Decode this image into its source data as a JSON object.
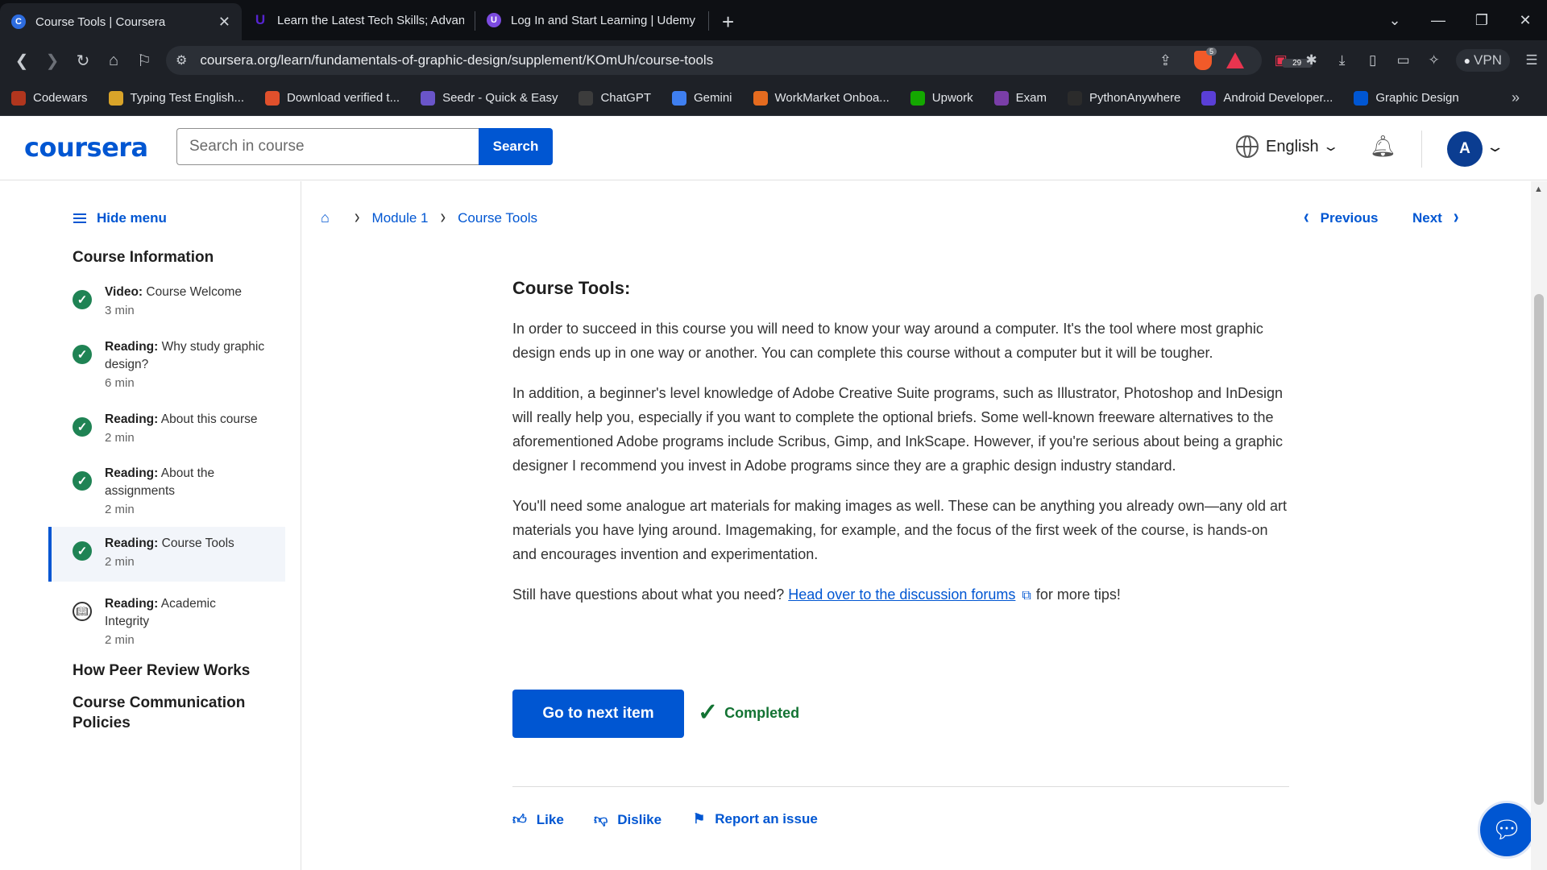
{
  "browser": {
    "tabs": [
      {
        "title": "Course Tools | Coursera",
        "active": true,
        "favicon": "coursera-favicon"
      },
      {
        "title": "Learn the Latest Tech Skills; Advanced",
        "active": false,
        "favicon": "udemy-favicon"
      },
      {
        "title": "Log In and Start Learning | Udemy",
        "active": false,
        "favicon": "udemy-favicon"
      }
    ],
    "url": "coursera.org/learn/fundamentals-of-graphic-design/supplement/KOmUh/course-tools",
    "extension_badges": {
      "brave_shields": "5",
      "ext_counter": "29"
    },
    "vpn_label": "VPN",
    "bookmarks": [
      {
        "label": "Codewars",
        "color": "#b1361e"
      },
      {
        "label": "Typing Test English...",
        "color": "#d9a429"
      },
      {
        "label": "Download verified t...",
        "color": "#e0502c"
      },
      {
        "label": "Seedr - Quick & Easy",
        "color": "#6a55c9"
      },
      {
        "label": "ChatGPT",
        "color": "#3c3c3c"
      },
      {
        "label": "Gemini",
        "color": "#3f7ff0"
      },
      {
        "label": "WorkMarket Onboa...",
        "color": "#e56b1f"
      },
      {
        "label": "Upwork",
        "color": "#14a800"
      },
      {
        "label": "Exam",
        "color": "#7a3ea8"
      },
      {
        "label": "PythonAnywhere",
        "color": "#2b2b2b"
      },
      {
        "label": "Android Developer...",
        "color": "#5a3fd6"
      },
      {
        "label": "Graphic Design",
        "color": "#0056d2"
      }
    ]
  },
  "header": {
    "logo": "coursera",
    "search_placeholder": "Search in course",
    "search_button": "Search",
    "language": "English",
    "avatar_initial": "A"
  },
  "sidebar": {
    "hide_menu": "Hide menu",
    "section_title": "Course Information",
    "items": [
      {
        "type": "Video:",
        "title": "Course Welcome",
        "duration": "3 min",
        "status": "completed"
      },
      {
        "type": "Reading:",
        "title": "Why study graphic design?",
        "duration": "6 min",
        "status": "completed"
      },
      {
        "type": "Reading:",
        "title": "About this course",
        "duration": "2 min",
        "status": "completed"
      },
      {
        "type": "Reading:",
        "title": "About the assignments",
        "duration": "2 min",
        "status": "completed"
      },
      {
        "type": "Reading:",
        "title": "Course Tools",
        "duration": "2 min",
        "status": "completed"
      },
      {
        "type": "Reading:",
        "title": "Academic Integrity",
        "duration": "2 min",
        "status": "not-started"
      }
    ],
    "sections": [
      "How Peer Review Works",
      "Course Communication Policies"
    ]
  },
  "breadcrumb": {
    "module": "Module 1",
    "page": "Course Tools"
  },
  "nav": {
    "previous": "Previous",
    "next": "Next"
  },
  "content": {
    "heading": "Course Tools:",
    "paragraphs": [
      "In order to succeed in this course you will need to know your way around a computer. It's the tool where most graphic design ends up in one way or another. You can complete this course without a computer but it will be tougher.",
      "In addition, a beginner's level knowledge of Adobe Creative Suite programs, such as Illustrator, Photoshop and InDesign will really help you, especially if you want to complete the optional briefs. Some well-known freeware alternatives to the aforementioned Adobe programs include Scribus, Gimp, and InkScape. However, if you're serious about being a graphic designer I recommend you invest in Adobe programs since they are a graphic design industry standard.",
      "You'll need some analogue art materials for making images as well. These can be anything you already own—any old art materials you have lying around. Imagemaking, for example, and the focus of the first week of the course, is hands-on and encourages invention and experimentation."
    ],
    "question_prefix": "Still have questions about what you need?",
    "forum_link": "Head over to the discussion forums",
    "question_suffix": "for more tips!"
  },
  "actions": {
    "next_item": "Go to next item",
    "completed": "Completed",
    "like": "Like",
    "dislike": "Dislike",
    "report": "Report an issue"
  },
  "colors": {
    "brand": "#0056d2",
    "success": "#1f8354"
  }
}
